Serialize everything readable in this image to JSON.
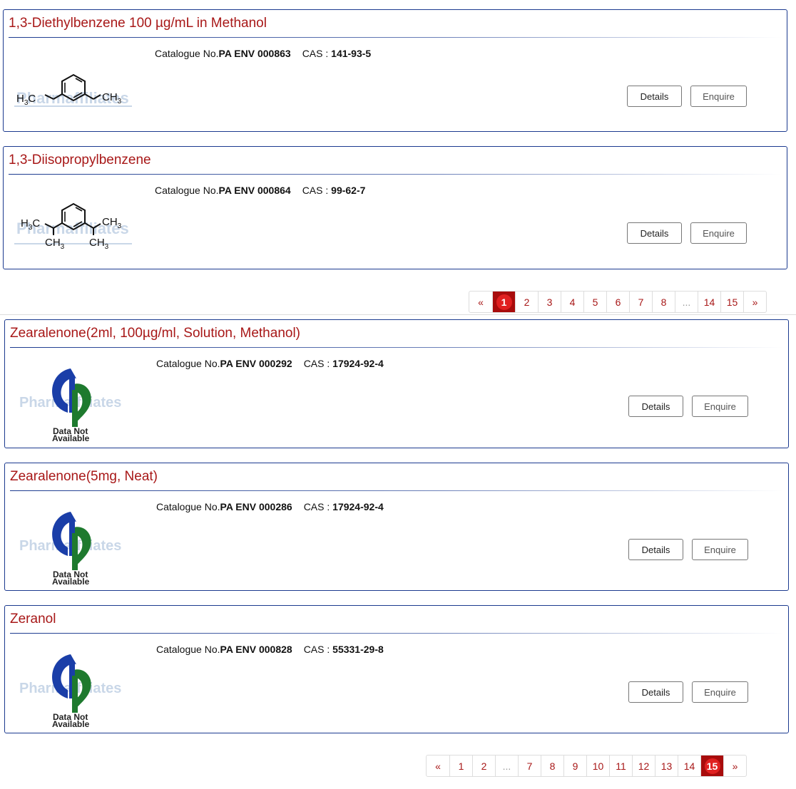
{
  "group1": {
    "products": [
      {
        "title": "1,3-Diethylbenzene 100 µg/mL in Methanol",
        "catalogue_label": "Catalogue No.",
        "catalogue_no": "PA ENV 000863",
        "cas_label": "CAS :",
        "cas": "141-93-5",
        "details": "Details",
        "enquire": "Enquire"
      },
      {
        "title": "1,3-Diisopropylbenzene",
        "catalogue_label": "Catalogue No.",
        "catalogue_no": "PA ENV 000864",
        "cas_label": "CAS :",
        "cas": "99-62-7",
        "details": "Details",
        "enquire": "Enquire"
      }
    ],
    "pagination": [
      "«",
      "1",
      "2",
      "3",
      "4",
      "5",
      "6",
      "7",
      "8",
      "...",
      "14",
      "15",
      "»"
    ],
    "active_page": "1"
  },
  "group2": {
    "products": [
      {
        "title": "Zearalenone(2ml, 100µg/ml, Solution, Methanol)",
        "catalogue_label": "Catalogue No.",
        "catalogue_no": "PA ENV 000292",
        "cas_label": "CAS :",
        "cas": "17924-92-4",
        "details": "Details",
        "enquire": "Enquire"
      },
      {
        "title": "Zearalenone(5mg, Neat)",
        "catalogue_label": "Catalogue No.",
        "catalogue_no": "PA ENV 000286",
        "cas_label": "CAS :",
        "cas": "17924-92-4",
        "details": "Details",
        "enquire": "Enquire"
      },
      {
        "title": "Zeranol",
        "catalogue_label": "Catalogue No.",
        "catalogue_no": "PA ENV 000828",
        "cas_label": "CAS :",
        "cas": "55331-29-8",
        "details": "Details",
        "enquire": "Enquire"
      }
    ],
    "pagination": [
      "«",
      "1",
      "2",
      "...",
      "7",
      "8",
      "9",
      "10",
      "11",
      "12",
      "13",
      "14",
      "15",
      "»"
    ],
    "active_page": "15"
  },
  "images": {
    "no_data_line1": "Data Not",
    "no_data_line2": "Available",
    "watermark": "Pharmaffiliates"
  },
  "colors": {
    "title": "#a81818",
    "border": "#1b3a8f",
    "active_page": "#e02020"
  }
}
